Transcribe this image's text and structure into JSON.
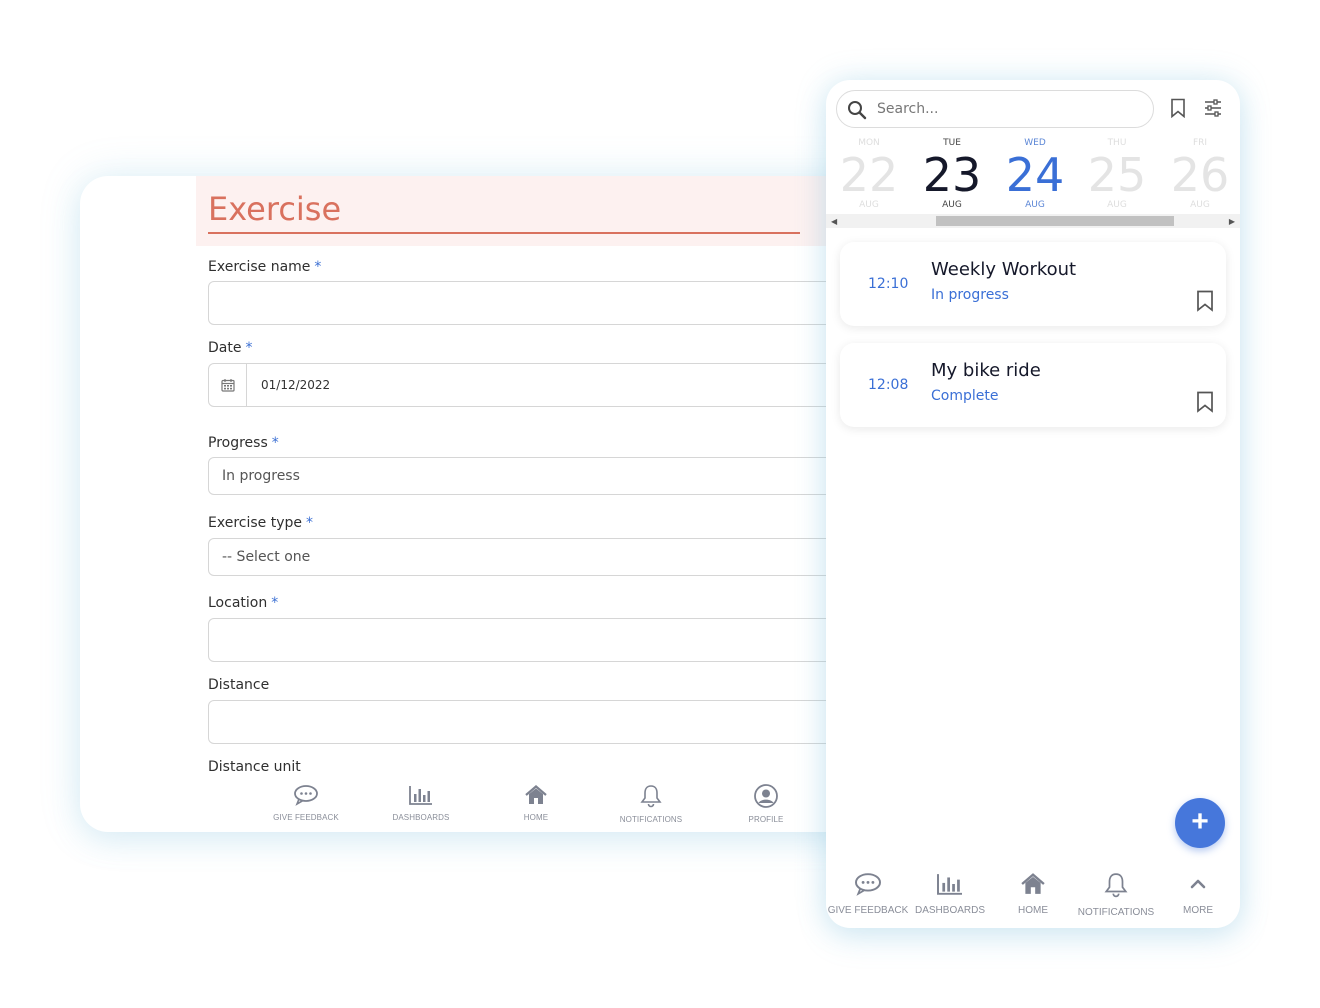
{
  "form": {
    "title": "Exercise",
    "fields": {
      "exercise_name": {
        "label": "Exercise name",
        "required_mark": "*",
        "value": ""
      },
      "date": {
        "label": "Date",
        "required_mark": "*",
        "value": "01/12/2022"
      },
      "progress": {
        "label": "Progress",
        "required_mark": "*",
        "value": "In progress"
      },
      "exercise_type": {
        "label": "Exercise type",
        "required_mark": "*",
        "value": "-- Select one"
      },
      "location": {
        "label": "Location",
        "required_mark": "*",
        "value": ""
      },
      "distance": {
        "label": "Distance",
        "value": ""
      },
      "distance_unit": {
        "label": "Distance unit"
      }
    },
    "nav": {
      "feedback": "GIVE FEEDBACK",
      "dashboards": "DASHBOARDS",
      "home": "HOME",
      "notifications": "NOTIFICATIONS",
      "profile": "PROFILE"
    }
  },
  "phone": {
    "search": {
      "placeholder": "Search..."
    },
    "days": [
      {
        "dow": "MON",
        "num": "22",
        "mon": "AUG"
      },
      {
        "dow": "TUE",
        "num": "23",
        "mon": "AUG"
      },
      {
        "dow": "WED",
        "num": "24",
        "mon": "AUG"
      },
      {
        "dow": "THU",
        "num": "25",
        "mon": "AUG"
      },
      {
        "dow": "FRI",
        "num": "26",
        "mon": "AUG"
      }
    ],
    "events": [
      {
        "time": "12:10",
        "title": "Weekly Workout",
        "status": "In progress"
      },
      {
        "time": "12:08",
        "title": "My bike ride",
        "status": "Complete"
      }
    ],
    "fab_symbol": "+",
    "nav": {
      "feedback": "GIVE FEEDBACK",
      "dashboards": "DASHBOARDS",
      "home": "HOME",
      "notifications": "NOTIFICATIONS",
      "more": "MORE"
    }
  },
  "colors": {
    "accent_blue": "#3a6fd6",
    "title_coral": "#d9715e",
    "header_bg": "#fdf1f0",
    "nav_gray": "#8a8e99"
  }
}
